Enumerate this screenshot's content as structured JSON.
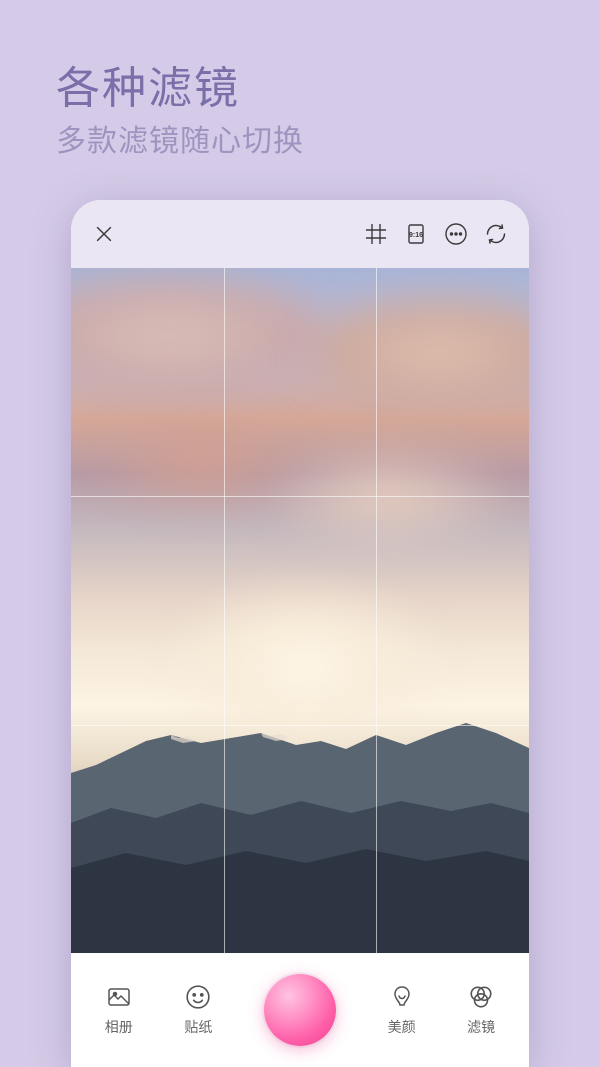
{
  "promo": {
    "title": "各种滤镜",
    "subtitle": "多款滤镜随心切换"
  },
  "topbar": {
    "aspect_label": "9:16"
  },
  "bottom": {
    "album": "相册",
    "sticker": "贴纸",
    "beauty": "美颜",
    "filter": "滤镜"
  }
}
